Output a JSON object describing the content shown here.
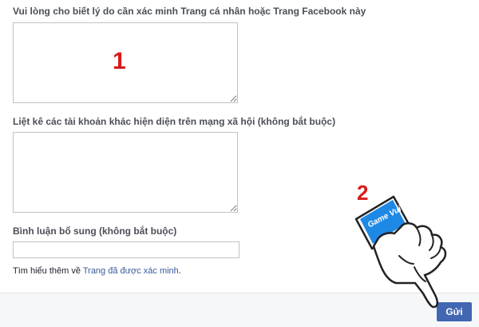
{
  "form": {
    "reason_label": "Vui lòng cho biết lý do cần xác minh Trang cá nhân hoặc Trang Facebook này",
    "reason_value": "",
    "social_accounts_label": "Liệt kê các tài khoản khác hiện diện trên mạng xã hội (không bắt buộc)",
    "social_accounts_value": "",
    "comment_label": "Bình luận bổ sung (không bắt buộc)",
    "comment_value": "",
    "help_prefix": "Tìm hiểu thêm về ",
    "help_link": "Trang đã được xác minh",
    "help_suffix": "."
  },
  "footer": {
    "send_label": "Gửi"
  },
  "annotations": {
    "step_1": "1",
    "step_2": "2",
    "badge_text": "Game Vui"
  },
  "colors": {
    "primary_button": "#4267b2",
    "link": "#365899",
    "annotation_red": "#d81b1b",
    "badge_blue": "#1e88e5"
  },
  "icons": {
    "pointer": "pointing-hand-icon"
  }
}
